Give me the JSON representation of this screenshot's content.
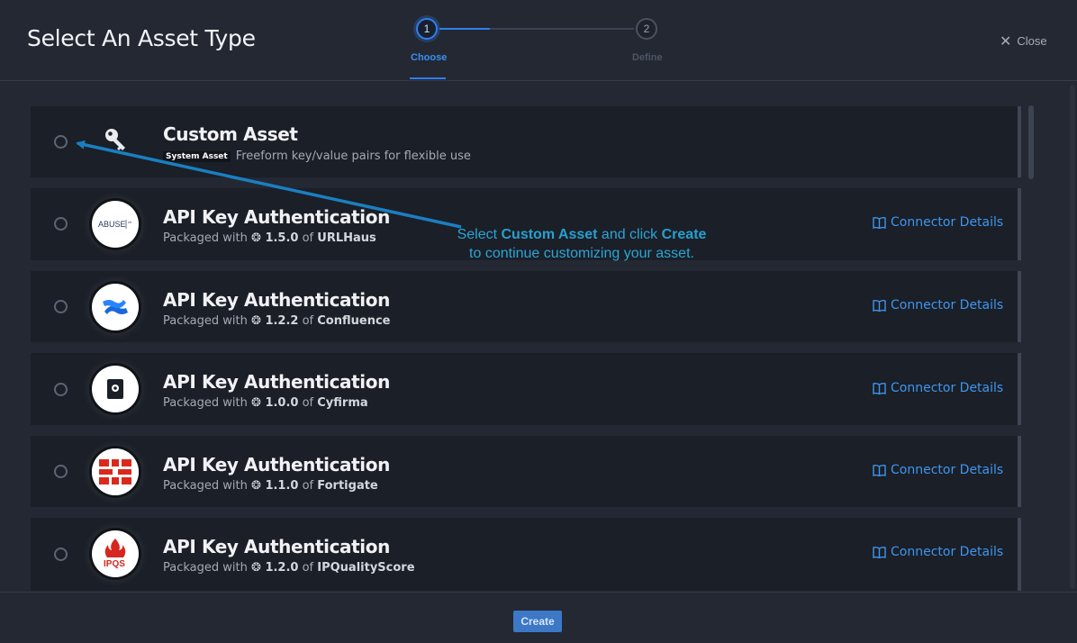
{
  "header": {
    "title": "Select An Asset Type",
    "steps": [
      {
        "number": "1",
        "label": "Choose",
        "active": true
      },
      {
        "number": "2",
        "label": "Define",
        "active": false
      }
    ],
    "close_label": "Close"
  },
  "assets": [
    {
      "title": "Custom Asset",
      "badge": "System Asset",
      "description": "Freeform key/value pairs for flexible use",
      "icon": "key-icon"
    },
    {
      "title": "API Key Authentication",
      "packaged_prefix": "Packaged with",
      "version": "1.5.0",
      "of": "of",
      "connector": "URLHaus",
      "details": "Connector Details",
      "logo": "abuse-ch-logo",
      "logo_text": "ABUSE",
      "logo_suffix": "ch"
    },
    {
      "title": "API Key Authentication",
      "packaged_prefix": "Packaged with",
      "version": "1.2.2",
      "of": "of",
      "connector": "Confluence",
      "details": "Connector Details",
      "logo": "confluence-logo"
    },
    {
      "title": "API Key Authentication",
      "packaged_prefix": "Packaged with",
      "version": "1.0.0",
      "of": "of",
      "connector": "Cyfirma",
      "details": "Connector Details",
      "logo": "cyfirma-logo"
    },
    {
      "title": "API Key Authentication",
      "packaged_prefix": "Packaged with",
      "version": "1.1.0",
      "of": "of",
      "connector": "Fortigate",
      "details": "Connector Details",
      "logo": "fortinet-logo"
    },
    {
      "title": "API Key Authentication",
      "packaged_prefix": "Packaged with",
      "version": "1.2.0",
      "of": "of",
      "connector": "IPQualityScore",
      "details": "Connector Details",
      "logo": "ipqs-logo",
      "logo_text": "IPQS"
    }
  ],
  "callout": {
    "part1": "Select ",
    "bold1": "Custom Asset",
    "part2": " and click ",
    "bold2": "Create",
    "part3": " to continue customizing your asset."
  },
  "footer": {
    "create_label": "Create"
  },
  "colors": {
    "accent": "#2f80ed",
    "link": "#3d96f0",
    "callout": "#2ba5d6"
  }
}
